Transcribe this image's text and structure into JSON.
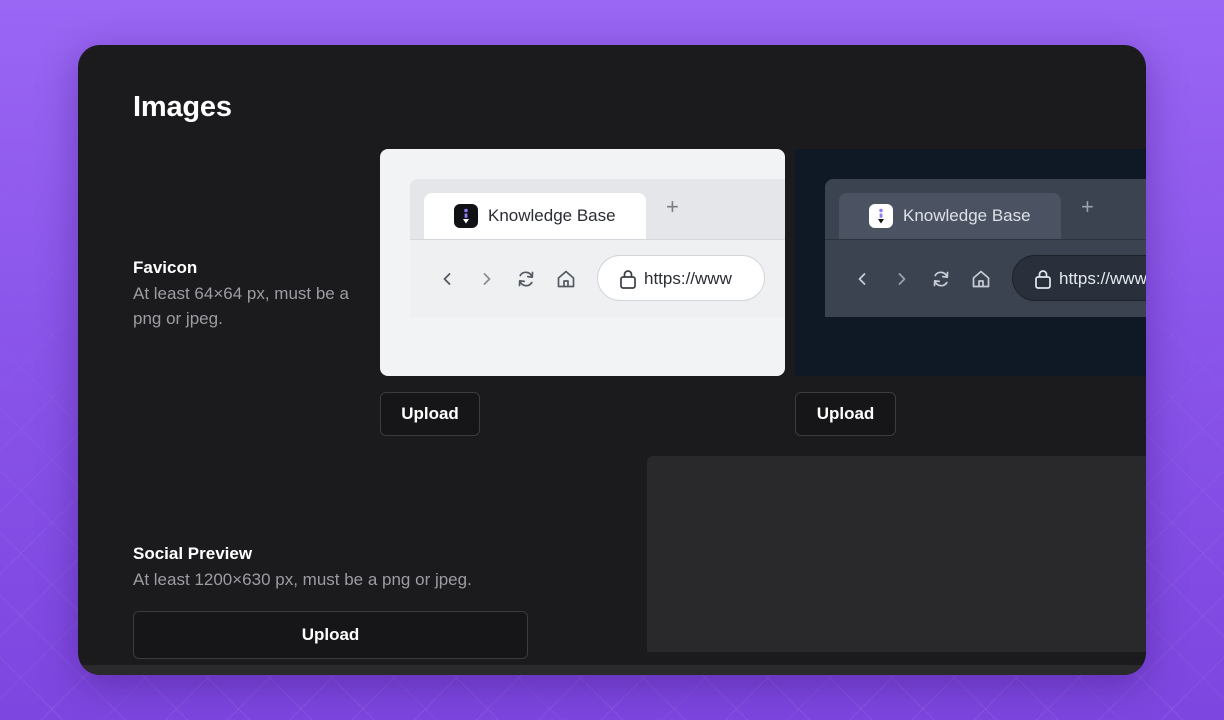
{
  "section": {
    "heading": "Images"
  },
  "favicon": {
    "label": "Favicon",
    "hint": "At least 64×64 px, must be a png or jpeg.",
    "light_preview": {
      "tab_title": "Knowledge Base",
      "url": "https://www"
    },
    "dark_preview": {
      "tab_title": "Knowledge Base",
      "url": "https://www"
    },
    "upload_light_label": "Upload",
    "upload_dark_label": "Upload"
  },
  "social_preview": {
    "label": "Social Preview",
    "hint": "At least 1200×630 px, must be a png or jpeg.",
    "upload_label": "Upload"
  },
  "icons": {
    "new_tab": "+",
    "back": "chevron-left-icon",
    "forward": "chevron-right-icon",
    "reload": "reload-icon",
    "home": "home-icon",
    "lock": "lock-icon",
    "cursor": "mouse-pointer-icon"
  },
  "colors": {
    "background_purple": "#8a55ea",
    "panel": "#1b1b1d",
    "button_border": "#3b3b40",
    "hint_text": "#9c9ca3"
  }
}
